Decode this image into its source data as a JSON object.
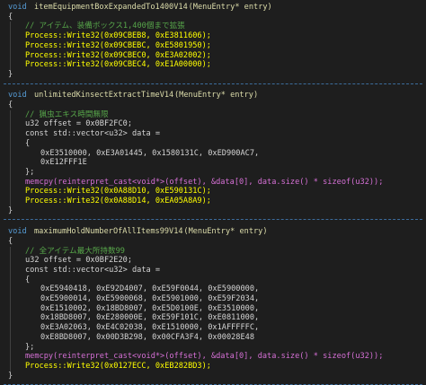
{
  "blocks": [
    {
      "signature": {
        "ret": "void",
        "name": "itemEquipmentBoxExpandedTo1400V14",
        "params": "(MenuEntry* entry)"
      },
      "open_brace": "{",
      "lines": [
        {
          "text": "// アイテム、装備ボックス1,400個まで拡張",
          "kind": "comment"
        },
        {
          "text": "Process::Write32(0x09CBEB8, 0xE3811606);",
          "kind": "write"
        },
        {
          "text": "Process::Write32(0x09CBEBC, 0xE5801950);",
          "kind": "write"
        },
        {
          "text": "Process::Write32(0x09CBEC0, 0xE3A02002);",
          "kind": "write"
        },
        {
          "text": "Process::Write32(0x09CBEC4, 0xE1A00000);",
          "kind": "write"
        }
      ],
      "close_brace": "}"
    },
    {
      "signature": {
        "ret": "void",
        "name": "unlimitedKinsectExtractTimeV14",
        "params": "(MenuEntry* entry)"
      },
      "open_brace": "{",
      "lines": [
        {
          "text": "// 猟虫エキス時間無限",
          "kind": "comment"
        },
        {
          "text": "u32 offset = 0x0BF2FC0;",
          "kind": "plain"
        },
        {
          "text": "const std::vector<u32> data =",
          "kind": "plain"
        },
        {
          "text": "{",
          "kind": "plain"
        },
        {
          "text": "0xE3510000, 0xE3A01445, 0x1580131C, 0xED900AC7,",
          "kind": "data"
        },
        {
          "text": "0xE12FFF1E",
          "kind": "data"
        },
        {
          "text": "};",
          "kind": "plain"
        },
        {
          "text": "memcpy(reinterpret_cast<void*>(offset), &data[0], data.size() * sizeof(u32));",
          "kind": "memcpy"
        },
        {
          "text": "Process::Write32(0x0A88D10, 0xE590131C);",
          "kind": "write"
        },
        {
          "text": "Process::Write32(0x0A88D14, 0xEA05A8A9);",
          "kind": "write"
        }
      ],
      "close_brace": "}"
    },
    {
      "signature": {
        "ret": "void",
        "name": "maximumHoldNumberOfAllItems99V14",
        "params": "(MenuEntry* entry)"
      },
      "open_brace": "{",
      "lines": [
        {
          "text": "// 全アイテム最大所持数99",
          "kind": "comment"
        },
        {
          "text": "u32 offset = 0x0BF2E20;",
          "kind": "plain"
        },
        {
          "text": "const std::vector<u32> data =",
          "kind": "plain"
        },
        {
          "text": "{",
          "kind": "plain"
        },
        {
          "text": "0xE5940418, 0xE92D4007, 0xE59F0044, 0xE5900000,",
          "kind": "data"
        },
        {
          "text": "0xE5900014, 0xE5900068, 0xE5901000, 0xE59F2034,",
          "kind": "data"
        },
        {
          "text": "0xE1510002, 0x18BD8007, 0xE5D0100E, 0xE3510000,",
          "kind": "data"
        },
        {
          "text": "0x18BD8007, 0xE280000E, 0xE59F101C, 0xE0811000,",
          "kind": "data"
        },
        {
          "text": "0xE3A02063, 0xE4C02038, 0xE1510000, 0x1AFFFFFC,",
          "kind": "data"
        },
        {
          "text": "0xE8BD8007, 0x00D3B298, 0x00CFA3F4, 0x00028E48",
          "kind": "data"
        },
        {
          "text": "};",
          "kind": "plain"
        },
        {
          "text": "memcpy(reinterpret_cast<void*>(offset), &data[0], data.size() * sizeof(u32));",
          "kind": "memcpy"
        },
        {
          "text": "Process::Write32(0x0127ECC, 0xEB282BD3);",
          "kind": "write"
        }
      ],
      "close_brace": "}"
    }
  ],
  "colors": {
    "background": "#1e1e1e",
    "keyword": "#569cd6",
    "function": "#dcdcaa",
    "comment": "#57a64a",
    "type": "#4ec9b0",
    "number": "#b5cea8",
    "highlight": "#ffff00",
    "memcpy": "#d670d6",
    "separator": "#3c6c9c"
  }
}
